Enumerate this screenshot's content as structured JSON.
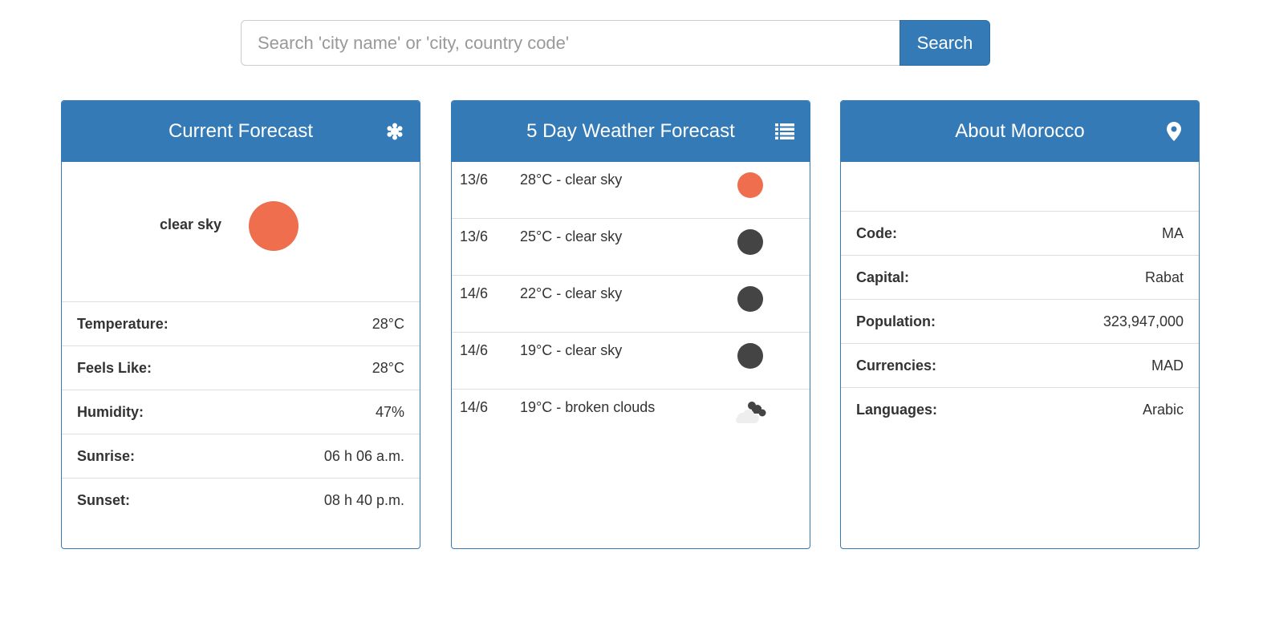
{
  "search": {
    "placeholder": "Search 'city name' or 'city, country code'",
    "button_label": "Search"
  },
  "current": {
    "title": "Current Forecast",
    "icon": "snowflake-asterisk-icon",
    "description": "clear sky",
    "weather_icon": "sun-icon",
    "rows": [
      {
        "label": "Temperature:",
        "value": "28°C"
      },
      {
        "label": "Feels Like:",
        "value": "28°C"
      },
      {
        "label": "Humidity:",
        "value": "47%"
      },
      {
        "label": "Sunrise:",
        "value": "06 h 06 a.m."
      },
      {
        "label": "Sunset:",
        "value": "08 h 40 p.m."
      }
    ]
  },
  "forecast": {
    "title": "5 Day Weather Forecast",
    "icon": "list-icon",
    "items": [
      {
        "date": "13/6",
        "text": "28°C - clear sky",
        "icon": "sun-icon"
      },
      {
        "date": "13/6",
        "text": "25°C - clear sky",
        "icon": "moon-icon"
      },
      {
        "date": "14/6",
        "text": "22°C - clear sky",
        "icon": "moon-icon"
      },
      {
        "date": "14/6",
        "text": "19°C - clear sky",
        "icon": "moon-icon"
      },
      {
        "date": "14/6",
        "text": "19°C - broken clouds",
        "icon": "broken-clouds-icon"
      }
    ]
  },
  "about": {
    "title": "About Morocco",
    "icon": "map-marker-icon",
    "rows": [
      {
        "label": "Code:",
        "value": "MA"
      },
      {
        "label": "Capital:",
        "value": "Rabat"
      },
      {
        "label": "Population:",
        "value": "323,947,000"
      },
      {
        "label": "Currencies:",
        "value": "MAD"
      },
      {
        "label": "Languages:",
        "value": "Arabic"
      }
    ]
  },
  "colors": {
    "primary": "#337ab7",
    "sun": "#ee6e4e",
    "night": "#444444"
  }
}
